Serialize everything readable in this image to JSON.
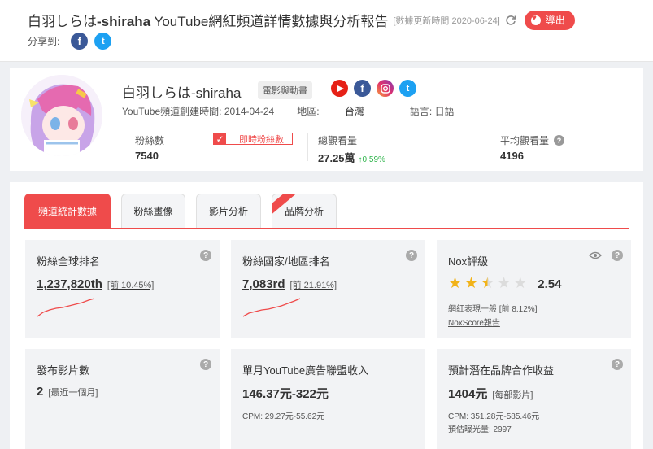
{
  "header": {
    "title_name": "白羽しらは",
    "title_handle": "-shiraha",
    "title_suffix": " YouTube網紅頻道詳情數據與分析報告",
    "update_text": "[數據更新時間 2020-06-24]",
    "export_label": "導出",
    "share_label": "分享到:"
  },
  "profile": {
    "name": "白羽しらは-shiraha",
    "category": "電影與動畫",
    "created": "YouTube頻道創建時間: 2014-04-24",
    "region_label": "地區:",
    "region_value": "台灣",
    "language": "語言: 日語",
    "subs_label": "粉絲數",
    "subs_value": "7540",
    "live_subs_label": "即時粉絲數",
    "views_label": "總觀看量",
    "views_value": "27.25萬",
    "views_growth": "↑0.59%",
    "avg_label": "平均觀看量",
    "avg_value": "4196"
  },
  "tabs": [
    "頻道統計數據",
    "粉絲畫像",
    "影片分析",
    "品牌分析"
  ],
  "cards": {
    "global_rank": {
      "title": "粉絲全球排名",
      "value": "1,237,820th",
      "sub": "[前 10.45%]"
    },
    "country_rank": {
      "title": "粉絲國家/地區排名",
      "value": "7,083rd",
      "sub": "[前 21.91%]"
    },
    "nox": {
      "title": "Nox評級",
      "score": "2.54",
      "rating": 2.5,
      "desc": "網紅表現一般 [前 8.12%]",
      "link": "NoxScore報告"
    },
    "videos": {
      "title": "發布影片數",
      "value": "2",
      "sub": "[最近一個月]"
    },
    "ad_income": {
      "title": "單月YouTube廣告聯盟收入",
      "value": "146.37元-322元",
      "cpm": "CPM: 29.27元-55.62元"
    },
    "brand_income": {
      "title": "預計潛在品牌合作收益",
      "value": "1404元",
      "sub": "[每部影片]",
      "cpm": "CPM: 351.28元-585.46元",
      "exposure": "預估曝光量: 2997"
    }
  },
  "colors": {
    "accent": "#ef4b4b",
    "star": "#f2b318",
    "growth": "#2db44a"
  }
}
